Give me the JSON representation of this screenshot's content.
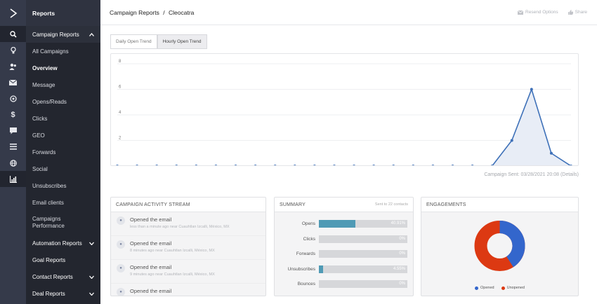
{
  "nav": {
    "title": "Reports",
    "section_campaign": "Campaign Reports",
    "campaign_items": [
      "All Campaigns",
      "Overview",
      "Message",
      "Opens/Reads",
      "Clicks",
      "GEO",
      "Forwards",
      "Social",
      "Unsubscribes",
      "Email clients"
    ],
    "campaigns_performance": "Campaigns Performance",
    "automation_reports": "Automation Reports",
    "goal_reports": "Goal Reports",
    "contact_reports": "Contact Reports",
    "deal_reports": "Deal Reports"
  },
  "rail_icons": [
    "search-icon",
    "lightbulb-icon",
    "contacts-icon",
    "mail-icon",
    "target-icon",
    "dollar-icon",
    "chat-icon",
    "list-icon",
    "globe-icon",
    "bar-chart-icon"
  ],
  "header": {
    "breadcrumb_parent": "Campaign Reports",
    "breadcrumb_sep": "/",
    "breadcrumb_current": "Cleocatra",
    "resend_label": "Resend Options",
    "share_label": "Share"
  },
  "tabs": {
    "daily": "Daily Open Trend",
    "hourly": "Hourly Open Trend"
  },
  "sent_text": "Campaign Sent: 03/28/2021 20:08 (Details)",
  "chart_data": {
    "type": "area",
    "y_ticks": [
      "8",
      "6",
      "4",
      "2"
    ],
    "ylim": [
      0,
      8
    ],
    "values": [
      0,
      0,
      0,
      0,
      0,
      0,
      0,
      0,
      0,
      0,
      0,
      0,
      0,
      0,
      0,
      0,
      0,
      0,
      0,
      0,
      2,
      6,
      1,
      0
    ],
    "line_color": "#3d70b8",
    "fill_color": "#e8edf6",
    "grid": true
  },
  "activity": {
    "title": "CAMPAIGN ACTIVITY STREAM",
    "items": [
      {
        "title": "Opened the email",
        "meta": "less than a minute ago  near Cuauhtlan Izcalli, México, MX"
      },
      {
        "title": "Opened the email",
        "meta": "8 minutes ago  near Cuauhtlan Izcalli, México, MX"
      },
      {
        "title": "Opened the email",
        "meta": "9 minutes ago  near Cuauhtlan Izcalli, México, MX"
      },
      {
        "title": "Opened the email",
        "meta": ""
      }
    ]
  },
  "summary": {
    "title": "SUMMARY",
    "sent_to": "Sent to 22 contacts",
    "rows": [
      {
        "label": "Opens",
        "pct": "40.91%",
        "value": 40.91
      },
      {
        "label": "Clicks",
        "pct": "0%",
        "value": 0
      },
      {
        "label": "Forwards",
        "pct": "0%",
        "value": 0
      },
      {
        "label": "Unsubscribes",
        "pct": "4.55%",
        "value": 4.55
      },
      {
        "label": "Bounces",
        "pct": "0%",
        "value": 0
      }
    ]
  },
  "engagements": {
    "title": "ENGAGEMENTS",
    "opened_label": "Opened",
    "unopened_label": "Unopened",
    "opened_value": 40.91,
    "opened_color": "#3366cc",
    "unopened_color": "#dc3912"
  }
}
